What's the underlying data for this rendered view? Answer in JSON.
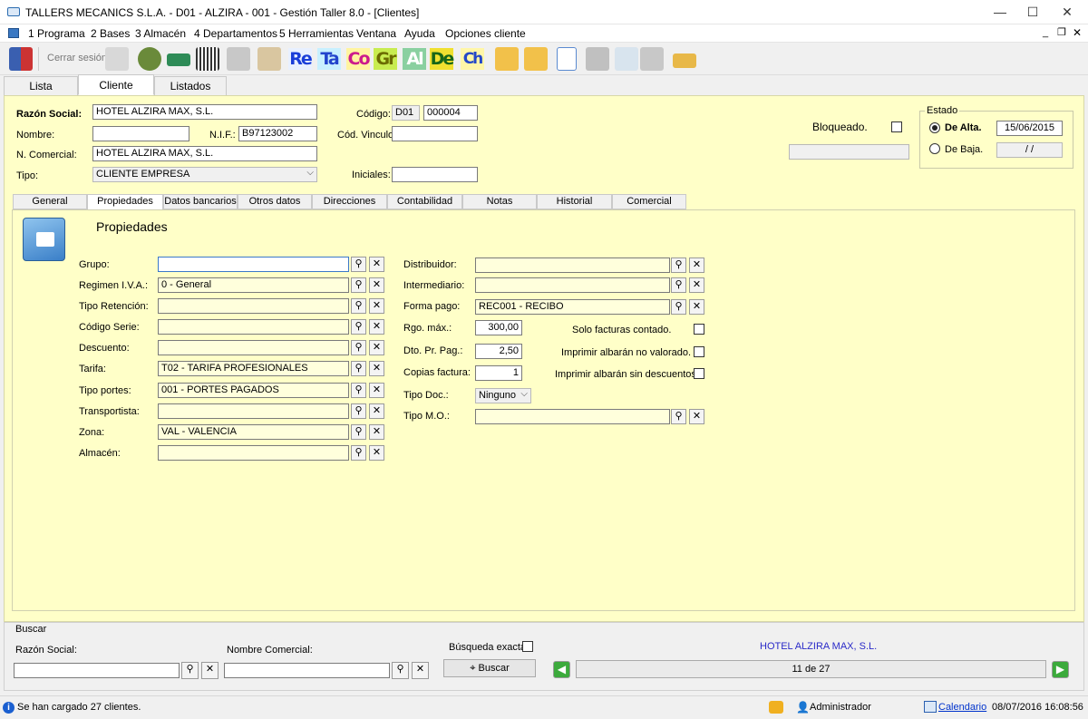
{
  "window": {
    "title": "TALLERS MECANICS S.L.A. - D01 - ALZIRA - 001 - Gestión Taller 8.0 - [Clientes]",
    "minimize": "—",
    "maximize": "☐",
    "close": "✕"
  },
  "menu": {
    "items": [
      "1 Programa",
      "2 Bases",
      "3 Almacén",
      "4 Departamentos",
      "5 Herramientas",
      "Ventana",
      "Ayuda",
      "Opciones cliente"
    ],
    "mdi_min": "_",
    "mdi_restore": "❐",
    "mdi_close": "✕"
  },
  "toolbar": {
    "cerrar_sesion": "Cerrar sesión",
    "text_buttons": [
      "Re",
      "Ta",
      "Co",
      "Gr",
      "Al",
      "De",
      "Ch"
    ],
    "icons": [
      "exit-door-icon",
      "key-icon",
      "users-icon",
      "car-icon",
      "barcode-icon",
      "truck-icon",
      "clipboard-icon",
      "folder-c-icon",
      "folder-g-icon",
      "new-document-icon",
      "save-disk-icon",
      "recycle-bin-icon",
      "printer-icon",
      "eraser-icon"
    ]
  },
  "tabs": [
    "Lista",
    "Cliente",
    "Listados"
  ],
  "header": {
    "razon_social_label": "Razón Social:",
    "razon_social": "HOTEL ALZIRA MAX, S.L.",
    "nombre_label": "Nombre:",
    "nombre": "",
    "nif_label": "N.I.F.:",
    "nif": "B97123002",
    "n_comercial_label": "N. Comercial:",
    "n_comercial": "HOTEL ALZIRA MAX, S.L.",
    "tipo_label": "Tipo:",
    "tipo": "CLIENTE EMPRESA",
    "codigo_label": "Código:",
    "codigo_prefix": "D01",
    "codigo": "000004",
    "cod_vinculo_label": "Cód. Vinculo",
    "cod_vinculo": "",
    "iniciales_label": "Iniciales:",
    "iniciales": "",
    "bloqueado_label": "Bloqueado.",
    "estado_label": "Estado",
    "de_alta_label": "De Alta.",
    "de_alta_date": "15/06/2015",
    "de_baja_label": "De Baja.",
    "de_baja_date": "/ /"
  },
  "subtabs": [
    "General",
    "Propiedades",
    "Datos bancarios",
    "Otros datos",
    "Direcciones",
    "Contabilidad",
    "Notas",
    "Historial",
    "Comercial"
  ],
  "propiedades": {
    "title": "Propiedades",
    "left": [
      {
        "label": "Grupo:",
        "value": ""
      },
      {
        "label": "Regimen I.V.A.:",
        "value": "0 - General"
      },
      {
        "label": "Tipo Retención:",
        "value": ""
      },
      {
        "label": "Código Serie:",
        "value": ""
      },
      {
        "label": "Descuento:",
        "value": ""
      },
      {
        "label": "Tarifa:",
        "value": "T02 - TARIFA PROFESIONALES"
      },
      {
        "label": "Tipo portes:",
        "value": "001 - PORTES PAGADOS"
      },
      {
        "label": "Transportista:",
        "value": ""
      },
      {
        "label": "Zona:",
        "value": "VAL - VALENCIA"
      },
      {
        "label": "Almacén:",
        "value": ""
      }
    ],
    "distribuidor_label": "Distribuidor:",
    "distribuidor": "",
    "intermediario_label": "Intermediario:",
    "intermediario": "",
    "forma_pago_label": "Forma pago:",
    "forma_pago": "REC001 - RECIBO",
    "rgo_max_label": "Rgo. máx.:",
    "rgo_max": "300,00",
    "dto_pr_pag_label": "Dto. Pr. Pag.:",
    "dto_pr_pag": "2,50",
    "copias_factura_label": "Copias factura:",
    "copias_factura": "1",
    "tipo_doc_label": "Tipo Doc.:",
    "tipo_doc": "Ninguno",
    "tipo_mo_label": "Tipo M.O.:",
    "tipo_mo": "",
    "solo_facturas_label": "Solo facturas contado.",
    "imprimir_no_valorado_label": "Imprimir albarán no valorado.",
    "imprimir_sin_desc_label": "Imprimir albarán sin descuentos."
  },
  "buscar": {
    "title": "Buscar",
    "razon_social_label": "Razón Social:",
    "nombre_comercial_label": "Nombre Comercial:",
    "busqueda_exacta_label": "Búsqueda exacta.",
    "buscar_button": "Buscar",
    "current_record": "HOTEL ALZIRA MAX, S.L.",
    "position": "11 de 27"
  },
  "status": {
    "message": "Se han cargado 27 clientes.",
    "user": "Administrador",
    "calendar": "Calendario",
    "datetime": "08/07/2016 16:08:56"
  },
  "colors": {
    "panel": "#ffffc8",
    "field_yellow": "#ffffdc",
    "link": "#0033cc"
  }
}
